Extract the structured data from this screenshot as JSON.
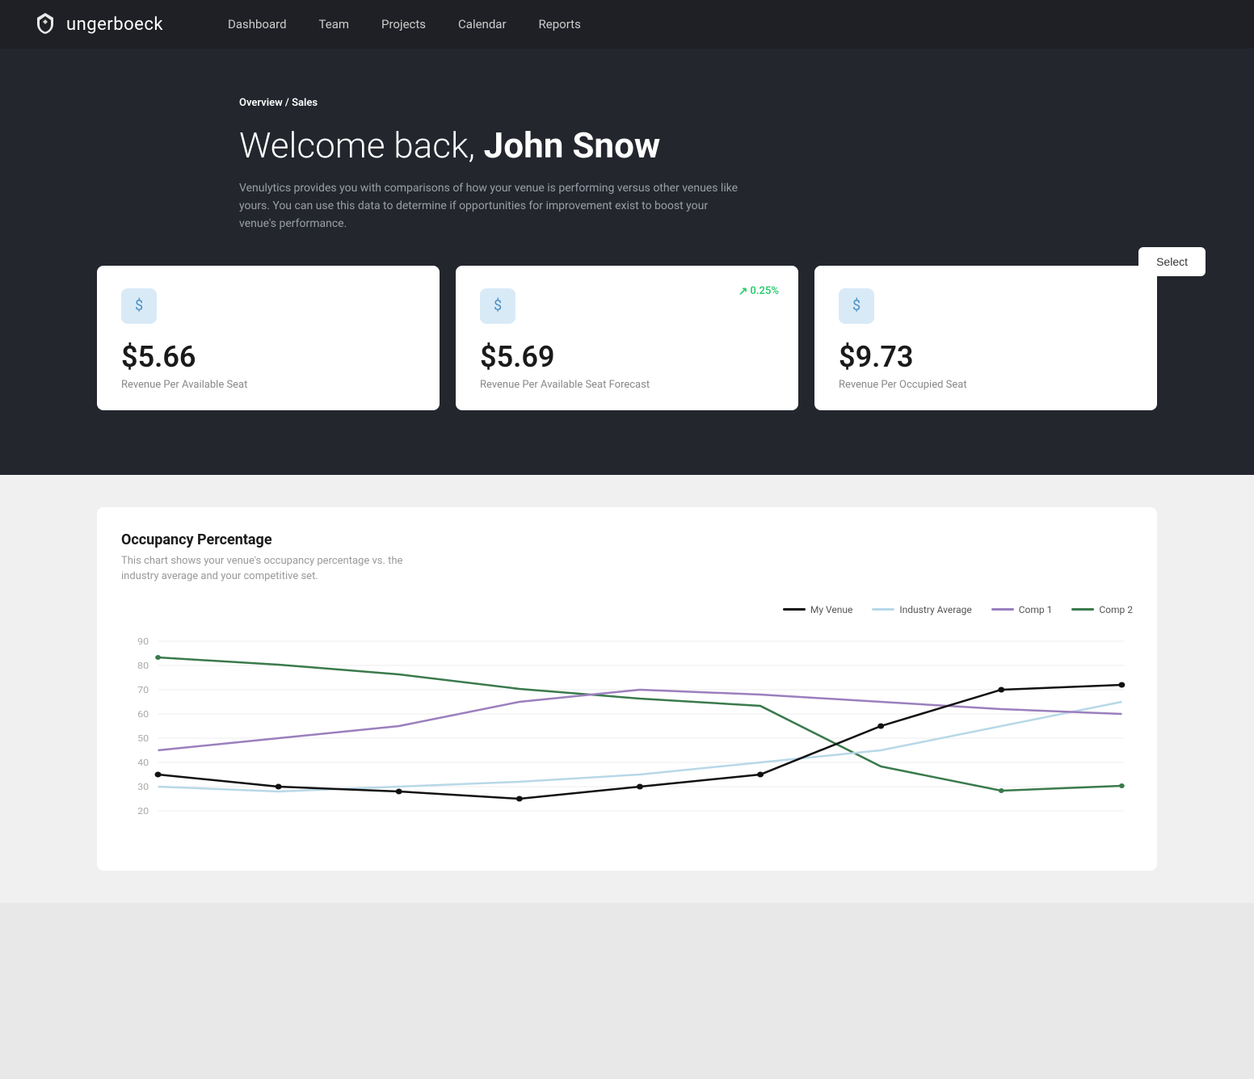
{
  "brand": {
    "name": "ungerboeck",
    "logo_alt": "Ungerboeck Logo"
  },
  "nav": {
    "items": [
      {
        "label": "Dashboard",
        "id": "dashboard"
      },
      {
        "label": "Team",
        "id": "team"
      },
      {
        "label": "Projects",
        "id": "projects"
      },
      {
        "label": "Calendar",
        "id": "calendar"
      },
      {
        "label": "Reports",
        "id": "reports"
      }
    ]
  },
  "hero": {
    "breadcrumb_overview": "Overview",
    "breadcrumb_sep": " / ",
    "breadcrumb_current": "Sales",
    "title_prefix": "Welcome back, ",
    "title_name": "John Snow",
    "description": "Venulytics provides you with comparisons of how your venue is performing versus other venues like yours. You can use this data to determine if opportunities for improvement exist to boost your venue's performance.",
    "select_button": "Select"
  },
  "metrics": [
    {
      "id": "revpar",
      "icon": "$",
      "value": "$5.66",
      "label": "Revenue Per Available Seat",
      "badge": null
    },
    {
      "id": "revpar-forecast",
      "icon": "$",
      "value": "$5.69",
      "label": "Revenue Per Available Seat Forecast",
      "badge": "0.25%",
      "badge_direction": "up"
    },
    {
      "id": "revpos",
      "icon": "$",
      "value": "$9.73",
      "label": "Revenue Per Occupied Seat",
      "badge": null
    }
  ],
  "chart": {
    "title": "Occupancy Percentage",
    "description": "This chart shows your venue's occupancy percentage vs. the industry average and your competitive set.",
    "legend": [
      {
        "label": "My Venue",
        "color": "#111111"
      },
      {
        "label": "Industry Average",
        "color": "#b8d8e8"
      },
      {
        "label": "Comp 1",
        "color": "#9b7fbd"
      },
      {
        "label": "Comp 2",
        "color": "#3a7a4c"
      }
    ],
    "y_axis": [
      90,
      80,
      70,
      60,
      50,
      40,
      30
    ],
    "series": {
      "my_venue": [
        35,
        30,
        28,
        25,
        30,
        35,
        55,
        70,
        72
      ],
      "industry_avg": [
        30,
        28,
        30,
        32,
        35,
        40,
        45,
        55,
        65
      ],
      "comp1": [
        45,
        50,
        55,
        65,
        70,
        68,
        65,
        62,
        60
      ],
      "comp2": [
        85,
        82,
        78,
        72,
        68,
        65,
        40,
        30,
        32
      ]
    }
  }
}
